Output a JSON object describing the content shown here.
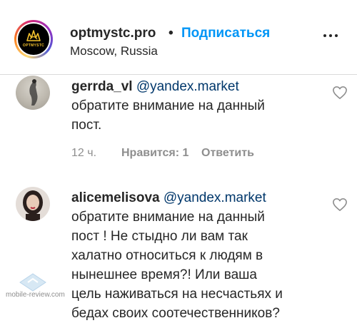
{
  "header": {
    "logo_text": "OPTMYSTC",
    "username": "optmystc.pro",
    "separator": "•",
    "follow_label": "Подписаться",
    "location": "Moscow, Russia",
    "more_icon": "more-horizontal-icon"
  },
  "comments": [
    {
      "username": "gerrda_vl",
      "mention": "@yandex.market",
      "line1": "обратите внимание на данный",
      "line2": "пост.",
      "time": "12 ч.",
      "likes": "Нравится: 1",
      "reply": "Ответить",
      "like_icon": "heart-outline-icon"
    },
    {
      "username": "alicemelisova",
      "mention": "@yandex.market",
      "line1": "обратите внимание на данный",
      "line2": "пост ! Не стыдно ли вам так",
      "line3": "халатно относиться к людям в",
      "line4": "нынешнее время?! Или ваша",
      "line5": "цель наживаться на несчастьях и",
      "line6": "бедах своих соотечественников?",
      "like_icon": "heart-outline-icon"
    }
  ],
  "watermark": {
    "text": "mobile-review.com"
  },
  "colors": {
    "link_blue": "#0095f6",
    "mention_blue": "#00376b",
    "meta_gray": "#8e8e8e",
    "text": "#262626"
  }
}
